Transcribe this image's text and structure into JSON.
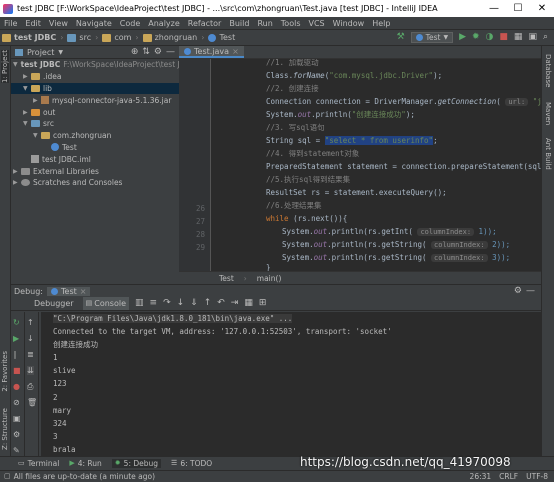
{
  "window": {
    "title": "test JDBC [F:\\WorkSpace\\IdeaProject\\test JDBC] - ...\\src\\com\\zhongruan\\Test.java [test JDBC] - IntelliJ IDEA",
    "minimize": "—",
    "maximize": "☐",
    "close": "✕"
  },
  "menu": [
    "File",
    "Edit",
    "View",
    "Navigate",
    "Code",
    "Analyze",
    "Refactor",
    "Build",
    "Run",
    "Tools",
    "VCS",
    "Window",
    "Help"
  ],
  "breadcrumbs": [
    "test JDBC",
    "src",
    "com",
    "zhongruan",
    "Test"
  ],
  "run_config": "Test",
  "left_strip": {
    "project": "1: Project",
    "favorites": "2: Favorites",
    "structure": "Z: Structure"
  },
  "right_strip": {
    "database": "Database",
    "maven": "Maven",
    "ant_build": "Ant Build"
  },
  "project_panel": {
    "header": "Project",
    "tree": [
      {
        "label": "test JDBC",
        "suffix": "F:\\WorkSpace\\IdeaProject\\test JDBC",
        "indent": 0,
        "arrow": "▼",
        "icon": "folder",
        "bold": true
      },
      {
        "label": ".idea",
        "indent": 1,
        "arrow": "▶",
        "icon": "folder"
      },
      {
        "label": "lib",
        "indent": 1,
        "arrow": "▼",
        "icon": "folder",
        "selected": true
      },
      {
        "label": "mysql-connector-java-5.1.36.jar",
        "indent": 2,
        "arrow": "▶",
        "icon": "jar"
      },
      {
        "label": "out",
        "indent": 1,
        "arrow": "▶",
        "icon": "folder-orange"
      },
      {
        "label": "src",
        "indent": 1,
        "arrow": "▼",
        "icon": "folder-blue"
      },
      {
        "label": "com.zhongruan",
        "indent": 2,
        "arrow": "▼",
        "icon": "folder"
      },
      {
        "label": "Test",
        "indent": 3,
        "arrow": "",
        "icon": "java"
      },
      {
        "label": "test JDBC.iml",
        "indent": 1,
        "arrow": "",
        "icon": "iml"
      },
      {
        "label": "External Libraries",
        "indent": 0,
        "arrow": "▶",
        "icon": "lib"
      },
      {
        "label": "Scratches and Consoles",
        "indent": 0,
        "arrow": "▶",
        "icon": "scratch"
      }
    ]
  },
  "editor": {
    "tab": "Test.java",
    "line_numbers": [
      "",
      "",
      "",
      "",
      "",
      "",
      "",
      "",
      "",
      "",
      "",
      "",
      "26",
      "27",
      "28",
      "29",
      ""
    ],
    "breadcrumb": [
      "Test",
      "main()"
    ]
  },
  "code_lines": {
    "l1": "//1. 加载驱动",
    "l2a": "Class.",
    "l2b": "forName",
    "l2c": "(",
    "l2d": "\"com.mysql.jdbc.Driver\"",
    "l2e": ");",
    "l3": "//2. 创建连接",
    "l4a": "Connection connection = DriverManager.",
    "l4b": "getConnection",
    "l4c": "( ",
    "l4d": "url:",
    "l4e": " \"jdbc:mysql",
    "l5a": "System.",
    "l5b": "out",
    "l5c": ".println(",
    "l5d": "\"创建连接成功\"",
    "l5e": ");",
    "l6": "//3. 写sql语句",
    "l7a": "String sql = ",
    "l7b": "\"select * from userinfo\"",
    "l7c": ";",
    "l8": "//4. 得到statement对象",
    "l9": "PreparedStatement statement = connection.prepareStatement(sql);",
    "l10": "//5.执行sql得到结果集",
    "l11": "ResultSet rs = statement.executeQuery();",
    "l12": "//6.处理结果集",
    "l13a": "while",
    "l13b": " (rs.next()){",
    "l14a": "System.",
    "l14b": "out",
    "l14c": ".println(rs.getInt( ",
    "l14d": "columnIndex:",
    "l14e": " 1));",
    "l15a": "System.",
    "l15b": "out",
    "l15c": ".println(rs.getString( ",
    "l15d": "columnIndex:",
    "l15e": " 2));",
    "l16a": "System.",
    "l16b": "out",
    "l16c": ".println(rs.getString( ",
    "l16d": "columnIndex:",
    "l16e": " 3));",
    "l17": "}"
  },
  "debug": {
    "label": "Debug:",
    "tab": "Test",
    "debugger_tab": "Debugger",
    "console_tab": "Console",
    "lines": [
      "\"C:\\Program Files\\Java\\jdk1.8.0_181\\bin\\java.exe\" ...",
      "Connected to the target VM, address: '127.0.0.1:52503', transport: 'socket'",
      "创建连接成功",
      "1",
      "slive",
      "123",
      "2",
      "mary",
      "324",
      "3",
      "brala",
      "139"
    ]
  },
  "bottom_tools": [
    "Terminal",
    "4: Run",
    "5: Debug",
    "6: TODO"
  ],
  "status": {
    "message": "All files are up-to-date (a minute ago)",
    "position": "26:31",
    "line_sep": "CRLF",
    "encoding": "UTF-8"
  },
  "watermark": "https://blog.csdn.net/qq_41970098"
}
